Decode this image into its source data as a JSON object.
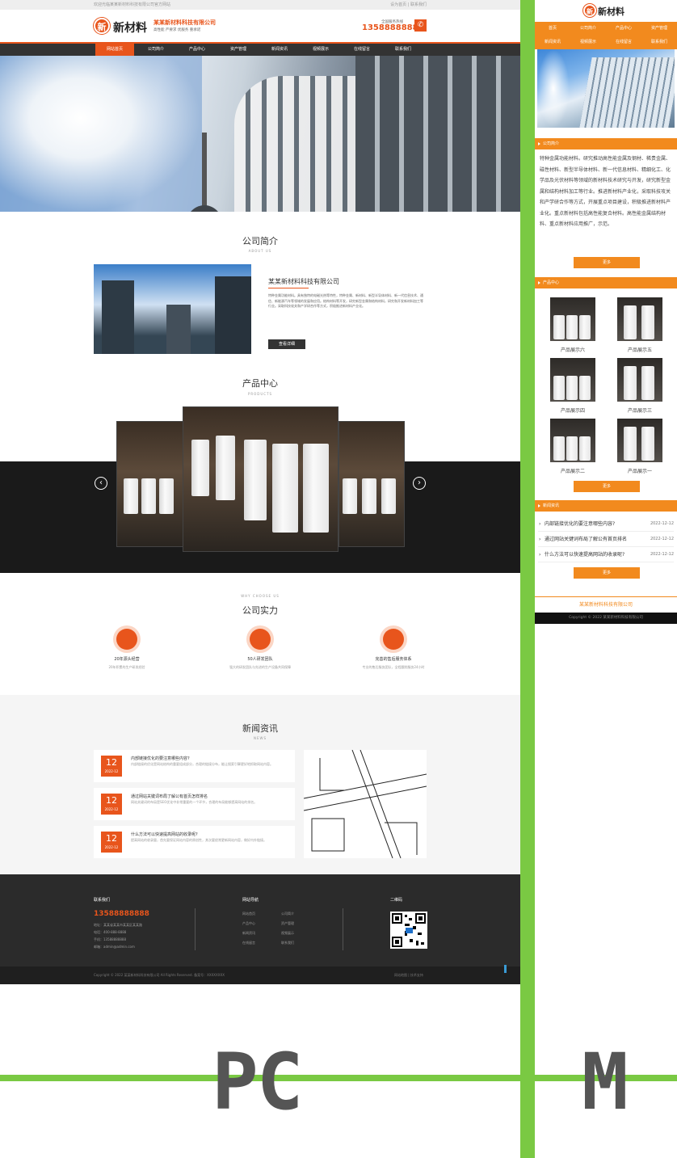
{
  "pc": {
    "topbar": {
      "left": "欢迎光临某某新材料科技有限公司官方网站",
      "right": "设为首页 | 联系我们"
    },
    "brand": {
      "logo_char": "新",
      "logo_name": "新材料",
      "company": "某某新材料科技有限公司",
      "slogan": "高性能  严要求  优服务  重承诺",
      "hotline_label": "全国服务热线",
      "hotline": "13588888888"
    },
    "nav": [
      "网站首页",
      "公司简介",
      "产品中心",
      "资产管理",
      "新闻资讯",
      "视频展示",
      "在线留言",
      "联系我们"
    ],
    "about": {
      "title": "公司简介",
      "subtitle": "ABOUT US",
      "company": "某某新材料科技有限公司",
      "text": "特种金属功能材料。具有独特的电磁光热等特性，特种金属、新材料、新型半导体材料、新一代信息技术、通信、新能源汽车等领域的发展和应用。结构材料等开发，研究新型金属和结构材料，研究和开发新材料加工等行业。采取科技攻关和产学研合作等方式，积极推进新材料产业化。",
      "button": "查看详细"
    },
    "products": {
      "title": "产品中心",
      "subtitle": "PRODUCTS",
      "prev": "‹",
      "next": "›"
    },
    "strength": {
      "subtitle": "WHY CHOOSE US",
      "title": "公司实力",
      "items": [
        {
          "title": "20年源头经营",
          "desc": "20年积累的生产研发经验"
        },
        {
          "title": "50人研发团队",
          "desc": "强大的研发团队与先进的生产设备共同保障"
        },
        {
          "title": "完善的售后服务体系",
          "desc": "专业的售后服务团队，全程跟踪服务24小时"
        }
      ]
    },
    "news": {
      "title": "新闻资讯",
      "subtitle": "NEWS",
      "items": [
        {
          "day": "12",
          "ym": "2022-12",
          "title": "内部链接优化的要注意哪些内容?",
          "summary": "内部链接的优化是网站结构的重要组成部分，合理的链接分布，能让搜索引擎更好地抓取网站内容。"
        },
        {
          "day": "12",
          "ym": "2022-12",
          "title": "通过网站关键词布局了解公有首页怎样排名",
          "summary": "网站关键词的布局是SEO优化中非常重要的一个环节，合理的布局能够提高网站的排名。"
        },
        {
          "day": "12",
          "ym": "2022-12",
          "title": "什么方法可以快速提高网站的收录呢?",
          "summary": "提高网站的收录量，首先要保证网站内容的原创性，其次要经常更新网站内容，做好内外链接。"
        }
      ]
    },
    "footer": {
      "contact_title": "联系我们",
      "phone": "13588888888",
      "lines": [
        "地址：某某省某某市某某区某某路",
        "电话：400-888-8888",
        "手机：13588888888",
        "邮箱：admin@admin.com"
      ],
      "nav_title": "网站导航",
      "nav_links": [
        "网站首页",
        "公司简介",
        "产品中心",
        "资产管理",
        "新闻资讯",
        "视频展示",
        "在线留言",
        "联系我们"
      ],
      "qr_title": "二维码",
      "copyright": "Copyright © 2022 某某新材料科技有限公司 All Rights Reserved. 备案号：XXXXXXXX",
      "right": "网站地图 | 技术支持"
    }
  },
  "mobile": {
    "brand": {
      "logo_char": "新",
      "logo_name": "新材料"
    },
    "nav": [
      "首页",
      "公司简介",
      "产品中心",
      "资产管理",
      "新闻资讯",
      "视频展示",
      "在线留言",
      "联系我们"
    ],
    "about": {
      "bar": "公司简介",
      "text": "特种金属功能材料。研究推动高性能金属及钢材、稀贵金属、磁性材料、新型半导体材料、新一代信息材料、精细化工、化学品及光伏材料等领域的新材料技术研究与开发，研究新型金属和结构材料加工等行业。推进新材料产业化，采取科技攻关和产学研合作等方式，开展重点项目建设，积极推进新材料产业化。重点新材料包括高性能复合材料。高性能金属结构材料、重点新材料应用推广，示范。",
      "button": "更多"
    },
    "products": {
      "bar": "产品中心",
      "items": [
        "产品展示六",
        "产品展示五",
        "产品展示四",
        "产品展示三",
        "产品展示二",
        "产品展示一"
      ],
      "button": "更多"
    },
    "news": {
      "bar": "新闻资讯",
      "items": [
        {
          "title": "内部链接优化的要注意哪些内容?",
          "date": "2022-12-12"
        },
        {
          "title": "通过网站关键词布局了解公有首页排名",
          "date": "2022-12-12"
        },
        {
          "title": "什么方法可以快速提高网站的收录呢?",
          "date": "2022-12-12"
        }
      ],
      "button": "更多"
    },
    "footer": {
      "company": "某某新材料科技有限公司",
      "copyright": "Copyright © 2022 某某新材料科技有限公司"
    }
  },
  "labels": {
    "pc": "PC",
    "m": "M"
  },
  "colors": {
    "accent": "#e8551c",
    "mobile_accent": "#f28a1e",
    "divider": "#7ac943"
  }
}
